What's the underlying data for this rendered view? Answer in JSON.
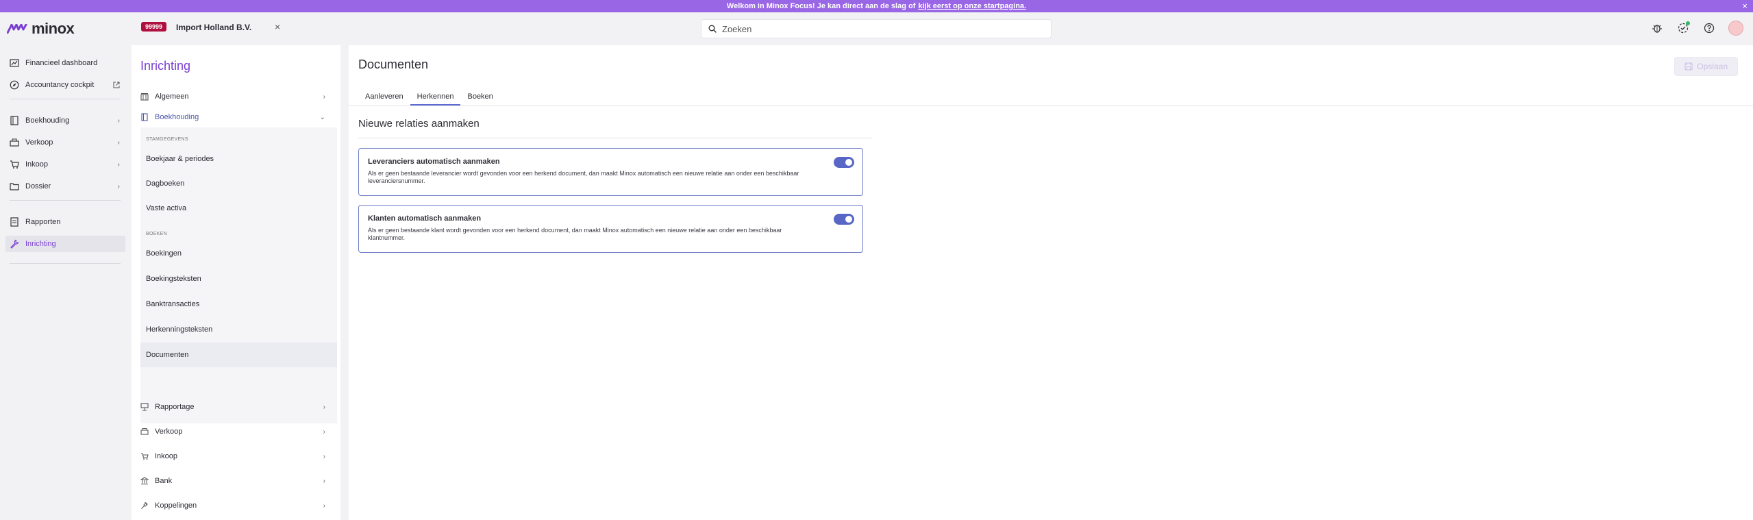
{
  "banner": {
    "text": "Welkom in Minox Focus! Je kan direct aan de slag of",
    "link": "kijk eerst op onze startpagina."
  },
  "app": {
    "logo": "minox"
  },
  "company": {
    "number": "99999",
    "name": "Import Holland B.V."
  },
  "search": {
    "placeholder": "Zoeken"
  },
  "leftnav": {
    "items": [
      {
        "label": "Financieel dashboard"
      },
      {
        "label": "Accountancy cockpit"
      },
      {
        "label": "Boekhouding"
      },
      {
        "label": "Verkoop"
      },
      {
        "label": "Inkoop"
      },
      {
        "label": "Dossier"
      },
      {
        "label": "Rapporten"
      },
      {
        "label": "Inrichting"
      }
    ]
  },
  "settings": {
    "title": "Inrichting",
    "sections": [
      {
        "label": "Algemeen"
      },
      {
        "label": "Boekhouding"
      },
      {
        "label": "Rapportage"
      },
      {
        "label": "Verkoop"
      },
      {
        "label": "Inkoop"
      },
      {
        "label": "Bank"
      },
      {
        "label": "Koppelingen"
      }
    ],
    "groups": [
      {
        "header": "STAMGEGEVENS",
        "items": [
          "Boekjaar & periodes",
          "Dagboeken",
          "Vaste activa"
        ]
      },
      {
        "header": "BOEKEN",
        "items": [
          "Boekingen",
          "Boekingsteksten",
          "Banktransacties",
          "Herkenningsteksten",
          "Documenten"
        ]
      }
    ]
  },
  "main": {
    "title": "Documenten",
    "save_label": "Opslaan",
    "tabs": [
      "Aanleveren",
      "Herkennen",
      "Boeken"
    ],
    "active_tab": "Herkennen",
    "section_title": "Nieuwe relaties aanmaken",
    "cards": [
      {
        "title": "Leveranciers automatisch aanmaken",
        "description": "Als er geen bestaande leverancier wordt gevonden voor een herkend document, dan maakt Minox automatisch een nieuwe relatie aan onder een beschikbaar leveranciersnummer.",
        "enabled": true
      },
      {
        "title": "Klanten automatisch aanmaken",
        "description": "Als er geen bestaande klant wordt gevonden voor een herkend document, dan maakt Minox automatisch een nieuwe relatie aan onder een beschikbaar klantnummer.",
        "enabled": true
      }
    ]
  },
  "colors": {
    "accent": "#7a3fd1",
    "banner": "#9966e6",
    "toggle": "#5867c6",
    "badge": "#b0103f"
  }
}
